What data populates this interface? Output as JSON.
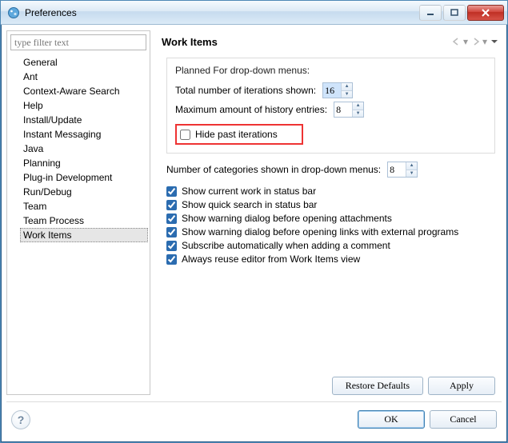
{
  "window": {
    "title": "Preferences"
  },
  "filter": {
    "placeholder": "type filter text"
  },
  "tree": {
    "items": [
      "General",
      "Ant",
      "Context-Aware Search",
      "Help",
      "Install/Update",
      "Instant Messaging",
      "Java",
      "Planning",
      "Plug-in Development",
      "Run/Debug",
      "Team",
      "Team Process",
      "Work Items"
    ],
    "selected_index": 12
  },
  "page": {
    "title": "Work Items",
    "group1": {
      "title": "Planned For drop-down menus:",
      "total_iterations_label": "Total number of iterations shown:",
      "total_iterations_value": "16",
      "history_label": "Maximum amount of history entries:",
      "history_value": "8",
      "hide_past_label": "Hide past iterations",
      "hide_past_checked": false
    },
    "categories_row": {
      "label": "Number of categories shown in drop-down menus:",
      "value": "8"
    },
    "checks": [
      {
        "label": "Show current work in status bar",
        "checked": true
      },
      {
        "label": "Show quick search in status bar",
        "checked": true
      },
      {
        "label": "Show warning dialog before opening attachments",
        "checked": true
      },
      {
        "label": "Show warning dialog before opening links with external programs",
        "checked": true
      },
      {
        "label": "Subscribe automatically when adding a comment",
        "checked": true
      },
      {
        "label": "Always reuse editor from Work Items view",
        "checked": true
      }
    ],
    "buttons": {
      "restore": "Restore Defaults",
      "apply": "Apply",
      "ok": "OK",
      "cancel": "Cancel"
    }
  }
}
